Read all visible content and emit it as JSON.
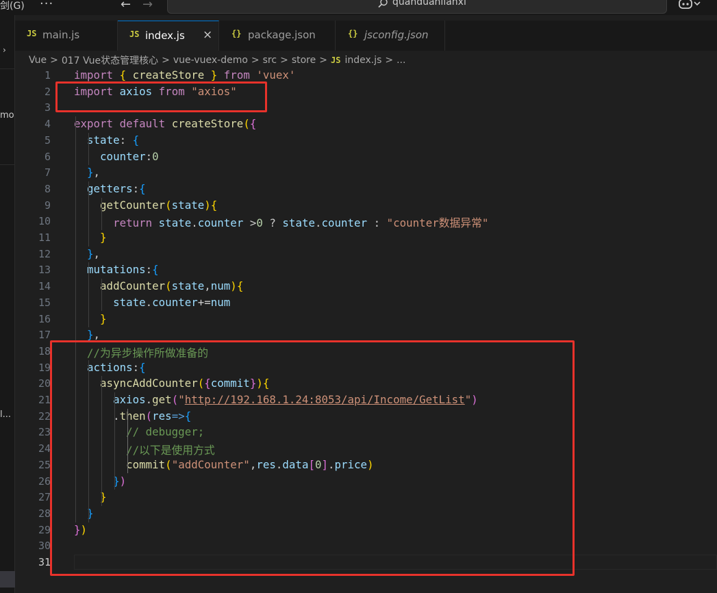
{
  "titlebar": {
    "menu_item": "剑(G)",
    "search_text": "quanduanlianxi"
  },
  "sidebar": {
    "fragments": [
      "mo",
      "l..."
    ]
  },
  "tabs": [
    {
      "icon": "JS",
      "label": "main.js",
      "active": false
    },
    {
      "icon": "JS",
      "label": "index.js",
      "active": true,
      "close": "×"
    },
    {
      "icon": "{}",
      "label": "package.json",
      "active": false
    },
    {
      "icon": "{}",
      "label": "jsconfig.json",
      "active": false,
      "italic": true
    }
  ],
  "breadcrumb": {
    "items": [
      "Vue",
      "017 Vue状态管理核心",
      "vue-vuex-demo",
      "src",
      "store"
    ],
    "file_icon": "JS",
    "file": "index.js",
    "trailing": "...",
    "separator": ">"
  },
  "editor": {
    "current_line": 31,
    "lines": [
      {
        "n": "1",
        "tokens": [
          [
            "kw",
            "import"
          ],
          [
            "pl",
            " "
          ],
          [
            "b1",
            "{"
          ],
          [
            "pl",
            " "
          ],
          [
            "fn",
            "createStore"
          ],
          [
            "pl",
            " "
          ],
          [
            "b1",
            "}"
          ],
          [
            "pl",
            " "
          ],
          [
            "kw",
            "from"
          ],
          [
            "pl",
            " "
          ],
          [
            "st",
            "'vuex'"
          ]
        ]
      },
      {
        "n": "2",
        "tokens": [
          [
            "kw",
            "import"
          ],
          [
            "pl",
            " "
          ],
          [
            "vr",
            "axios"
          ],
          [
            "pl",
            " "
          ],
          [
            "kw",
            "from"
          ],
          [
            "pl",
            " "
          ],
          [
            "st",
            "\"axios\""
          ]
        ]
      },
      {
        "n": "3",
        "tokens": []
      },
      {
        "n": "4",
        "tokens": [
          [
            "kw",
            "export"
          ],
          [
            "pl",
            " "
          ],
          [
            "kw",
            "default"
          ],
          [
            "pl",
            " "
          ],
          [
            "fn",
            "createStore"
          ],
          [
            "b1",
            "("
          ],
          [
            "b2",
            "{"
          ]
        ]
      },
      {
        "n": "5",
        "tokens": [
          [
            "pl",
            "  "
          ],
          [
            "vr",
            "state"
          ],
          [
            "pl",
            ": "
          ],
          [
            "b3",
            "{"
          ]
        ]
      },
      {
        "n": "6",
        "tokens": [
          [
            "pl",
            "    "
          ],
          [
            "vr",
            "counter"
          ],
          [
            "pl",
            ":"
          ],
          [
            "nu",
            "0"
          ]
        ]
      },
      {
        "n": "7",
        "tokens": [
          [
            "pl",
            "  "
          ],
          [
            "b3",
            "}"
          ],
          [
            "pl",
            ","
          ]
        ]
      },
      {
        "n": "8",
        "tokens": [
          [
            "pl",
            "  "
          ],
          [
            "vr",
            "getters"
          ],
          [
            "pl",
            ":"
          ],
          [
            "b3",
            "{"
          ]
        ]
      },
      {
        "n": "9",
        "tokens": [
          [
            "pl",
            "    "
          ],
          [
            "fn",
            "getCounter"
          ],
          [
            "b1",
            "("
          ],
          [
            "vr",
            "state"
          ],
          [
            "b1",
            ")"
          ],
          [
            "b1",
            "{"
          ]
        ]
      },
      {
        "n": "10",
        "tokens": [
          [
            "pl",
            "      "
          ],
          [
            "kw",
            "return"
          ],
          [
            "pl",
            " "
          ],
          [
            "vr",
            "state"
          ],
          [
            "pl",
            "."
          ],
          [
            "vr",
            "counter"
          ],
          [
            "pl",
            " >"
          ],
          [
            "nu",
            "0"
          ],
          [
            "pl",
            " ? "
          ],
          [
            "vr",
            "state"
          ],
          [
            "pl",
            "."
          ],
          [
            "vr",
            "counter"
          ],
          [
            "pl",
            " : "
          ],
          [
            "st",
            "\"counter数据异常\""
          ]
        ]
      },
      {
        "n": "11",
        "tokens": [
          [
            "pl",
            "    "
          ],
          [
            "b1",
            "}"
          ]
        ]
      },
      {
        "n": "12",
        "tokens": [
          [
            "pl",
            "  "
          ],
          [
            "b3",
            "}"
          ],
          [
            "pl",
            ","
          ]
        ]
      },
      {
        "n": "13",
        "tokens": [
          [
            "pl",
            "  "
          ],
          [
            "vr",
            "mutations"
          ],
          [
            "pl",
            ":"
          ],
          [
            "b3",
            "{"
          ]
        ]
      },
      {
        "n": "14",
        "tokens": [
          [
            "pl",
            "    "
          ],
          [
            "fn",
            "addCounter"
          ],
          [
            "b1",
            "("
          ],
          [
            "vr",
            "state"
          ],
          [
            "pl",
            ","
          ],
          [
            "vr",
            "num"
          ],
          [
            "b1",
            ")"
          ],
          [
            "b1",
            "{"
          ]
        ]
      },
      {
        "n": "15",
        "tokens": [
          [
            "pl",
            "      "
          ],
          [
            "vr",
            "state"
          ],
          [
            "pl",
            "."
          ],
          [
            "vr",
            "counter"
          ],
          [
            "pl",
            "+="
          ],
          [
            "vr",
            "num"
          ]
        ]
      },
      {
        "n": "16",
        "tokens": [
          [
            "pl",
            "    "
          ],
          [
            "b1",
            "}"
          ]
        ]
      },
      {
        "n": "17",
        "tokens": [
          [
            "pl",
            "  "
          ],
          [
            "b3",
            "}"
          ],
          [
            "pl",
            ","
          ]
        ]
      },
      {
        "n": "18",
        "tokens": [
          [
            "pl",
            "  "
          ],
          [
            "cm",
            "//为异步操作所做准备的"
          ]
        ]
      },
      {
        "n": "19",
        "tokens": [
          [
            "pl",
            "  "
          ],
          [
            "vr",
            "actions"
          ],
          [
            "pl",
            ":"
          ],
          [
            "b3",
            "{"
          ]
        ]
      },
      {
        "n": "20",
        "tokens": [
          [
            "pl",
            "    "
          ],
          [
            "fn",
            "asyncAddCounter"
          ],
          [
            "b1",
            "("
          ],
          [
            "b2",
            "{"
          ],
          [
            "vr",
            "commit"
          ],
          [
            "b2",
            "}"
          ],
          [
            "b1",
            ")"
          ],
          [
            "b1",
            "{"
          ]
        ]
      },
      {
        "n": "21",
        "tokens": [
          [
            "pl",
            "      "
          ],
          [
            "vr",
            "axios"
          ],
          [
            "pl",
            "."
          ],
          [
            "fn",
            "get"
          ],
          [
            "b2",
            "("
          ],
          [
            "st",
            "\""
          ],
          [
            "url",
            "http://192.168.1.24:8053/api/Income/GetList"
          ],
          [
            "st",
            "\""
          ],
          [
            "b2",
            ")"
          ]
        ]
      },
      {
        "n": "22",
        "tokens": [
          [
            "pl",
            "      ."
          ],
          [
            "fn",
            "then"
          ],
          [
            "b2",
            "("
          ],
          [
            "vr",
            "res"
          ],
          [
            "kb",
            "=>"
          ],
          [
            "b3",
            "{"
          ]
        ]
      },
      {
        "n": "23",
        "tokens": [
          [
            "pl",
            "        "
          ],
          [
            "cm",
            "// debugger;"
          ]
        ]
      },
      {
        "n": "24",
        "tokens": [
          [
            "pl",
            "        "
          ],
          [
            "cm",
            "//以下是使用方式"
          ]
        ]
      },
      {
        "n": "25",
        "tokens": [
          [
            "pl",
            "        "
          ],
          [
            "fn",
            "commit"
          ],
          [
            "b1",
            "("
          ],
          [
            "st",
            "\"addCounter\""
          ],
          [
            "pl",
            ","
          ],
          [
            "vr",
            "res"
          ],
          [
            "pl",
            "."
          ],
          [
            "vr",
            "data"
          ],
          [
            "b2",
            "["
          ],
          [
            "nu",
            "0"
          ],
          [
            "b2",
            "]"
          ],
          [
            "pl",
            "."
          ],
          [
            "vr",
            "price"
          ],
          [
            "b1",
            ")"
          ]
        ]
      },
      {
        "n": "26",
        "tokens": [
          [
            "pl",
            "      "
          ],
          [
            "b3",
            "}"
          ],
          [
            "b2",
            ")"
          ]
        ]
      },
      {
        "n": "27",
        "tokens": [
          [
            "pl",
            "    "
          ],
          [
            "b1",
            "}"
          ]
        ]
      },
      {
        "n": "28",
        "tokens": [
          [
            "pl",
            "  "
          ],
          [
            "b3",
            "}"
          ]
        ]
      },
      {
        "n": "29",
        "tokens": [
          [
            "b2",
            "}"
          ],
          [
            "b1",
            ")"
          ]
        ]
      },
      {
        "n": "30",
        "tokens": []
      },
      {
        "n": "31",
        "tokens": []
      }
    ]
  },
  "colors": {
    "annotation": "#e8322b",
    "active_tab_border": "#0078d4",
    "js_badge": "#cbcb41"
  }
}
